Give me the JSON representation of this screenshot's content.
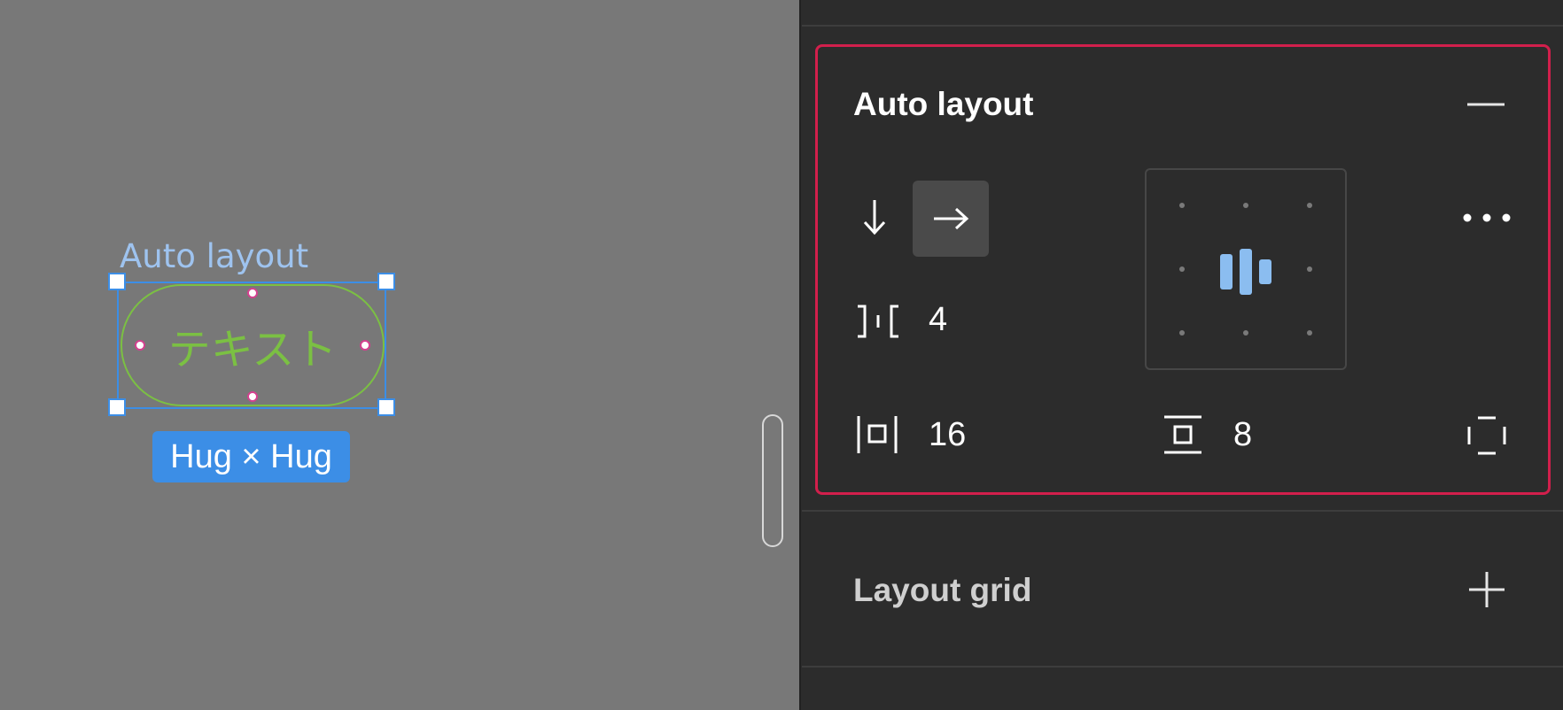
{
  "canvas": {
    "frame_label": "Auto layout",
    "text_content": "テキスト",
    "size_badge": "Hug × Hug"
  },
  "panel": {
    "auto_layout": {
      "title": "Auto layout",
      "collapse_icon": "minus-icon",
      "direction": {
        "options": [
          "vertical",
          "horizontal"
        ],
        "selected": "horizontal",
        "icons": [
          "arrow-down-icon",
          "arrow-right-icon"
        ]
      },
      "gap": "4",
      "horizontal_padding": "16",
      "vertical_padding": "8",
      "alignment": "center-middle",
      "more_icon": "more-horizontal-icon",
      "individual_padding_icon": "individual-padding-icon"
    },
    "layout_grid": {
      "title": "Layout grid",
      "add_icon": "plus-icon"
    }
  },
  "colors": {
    "selection": "#3c8ee6",
    "text_green": "#7bc043",
    "highlight": "#d21f4c",
    "accent_bar": "#8bbdf0"
  }
}
